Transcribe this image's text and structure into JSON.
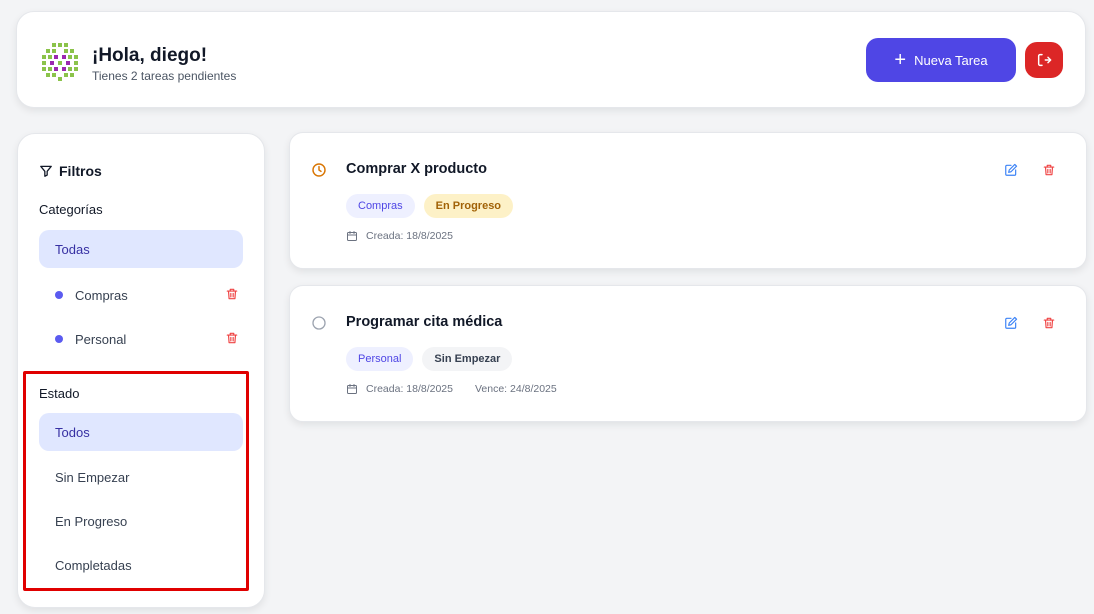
{
  "colors": {
    "primary": "#4f46e5",
    "danger": "#dc2626",
    "active_bg": "#e0e7ff",
    "category_dot": "#5b5bf0",
    "in_progress": "#d97706",
    "highlight": "#e00000"
  },
  "header": {
    "avatar_icon": "cluster-avatar-icon",
    "greeting": "¡Hola, diego!",
    "subtitle": "Tienes 2 tareas pendientes",
    "new_task_label": "Nueva Tarea",
    "new_task_icon": "plus-icon",
    "logout_icon": "logout-icon"
  },
  "sidebar": {
    "title": "Filtros",
    "title_icon": "filter-icon",
    "categories_heading": "Categorías",
    "categories": [
      {
        "label": "Todas",
        "active": true
      },
      {
        "label": "Compras",
        "active": false
      },
      {
        "label": "Personal",
        "active": false
      }
    ],
    "state_heading": "Estado",
    "states": [
      {
        "label": "Todos",
        "active": true
      },
      {
        "label": "Sin Empezar",
        "active": false
      },
      {
        "label": "En Progreso",
        "active": false
      },
      {
        "label": "Completadas",
        "active": false
      }
    ]
  },
  "tasks": [
    {
      "title": "Comprar X producto",
      "status_icon": "clock-icon",
      "category": "Compras",
      "status": "En Progreso",
      "created": "Creada: 18/8/2025",
      "due": ""
    },
    {
      "title": "Programar cita médica",
      "status_icon": "empty-circle-icon",
      "category": "Personal",
      "status": "Sin Empezar",
      "created": "Creada: 18/8/2025",
      "due": "Vence: 24/8/2025"
    }
  ]
}
